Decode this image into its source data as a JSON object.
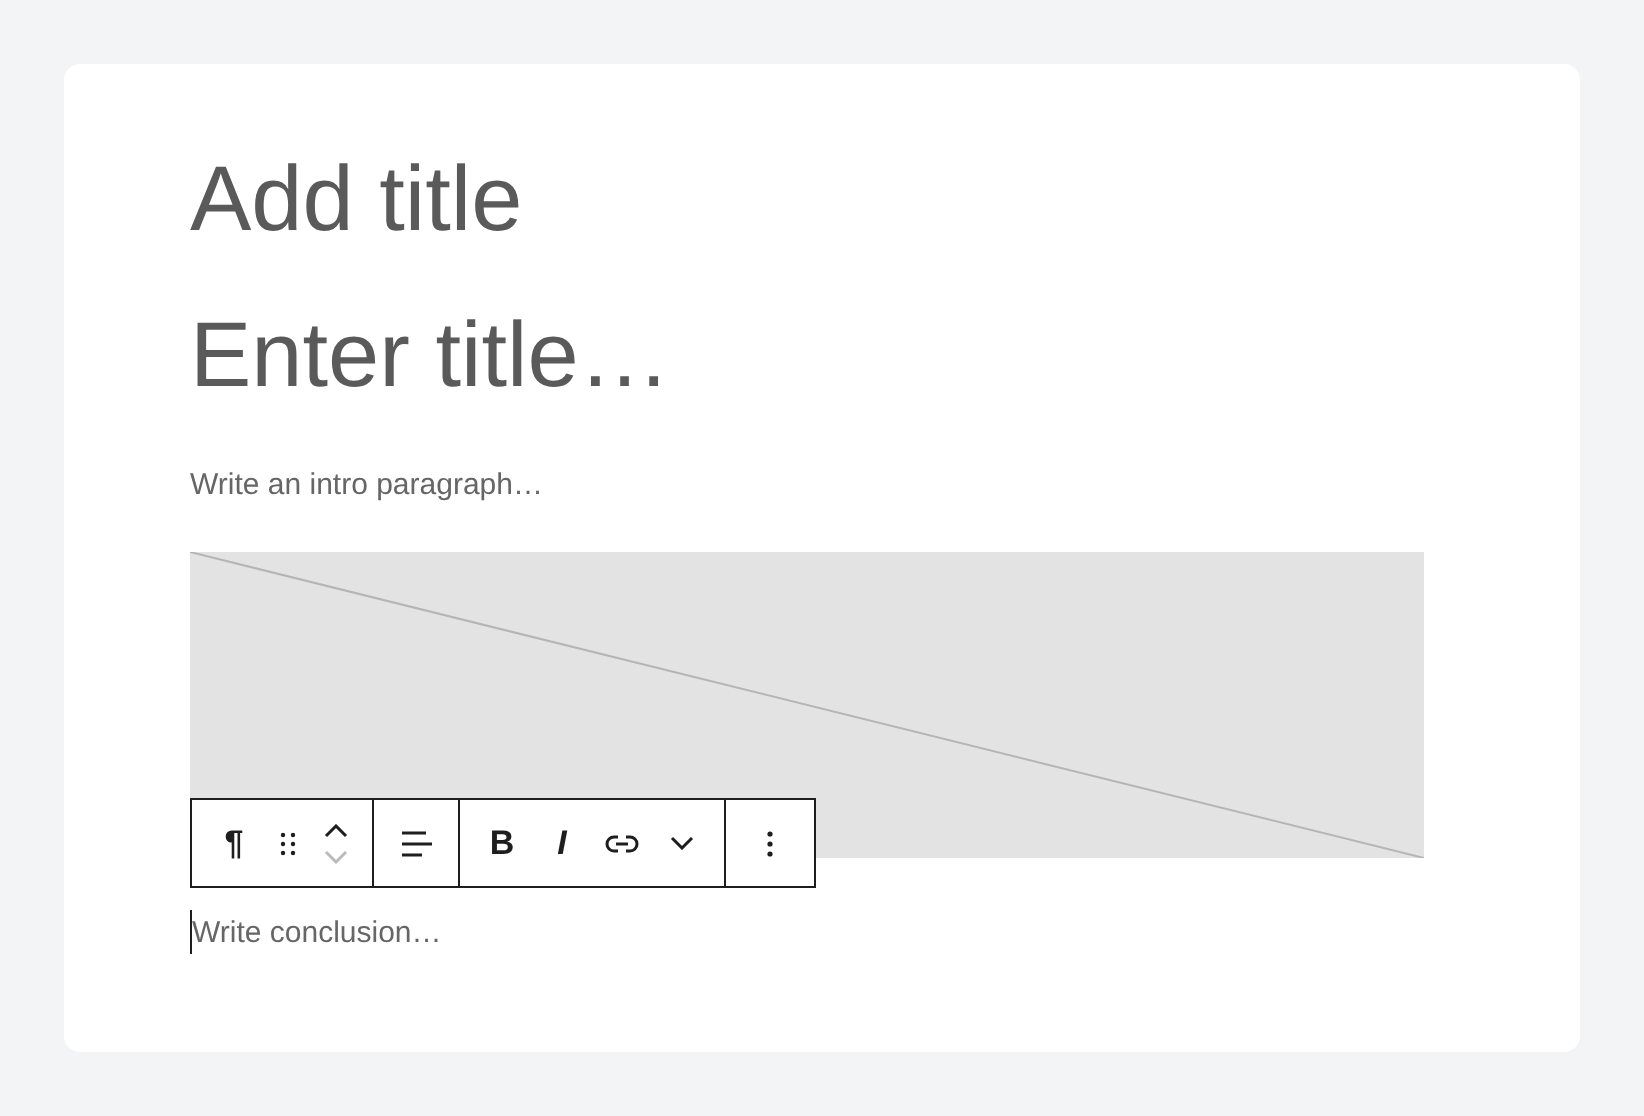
{
  "title": {
    "placeholder": "Add title"
  },
  "heading": {
    "placeholder": "Enter title…"
  },
  "intro": {
    "placeholder": "Write an intro paragraph…"
  },
  "image": {
    "kind": "placeholder"
  },
  "toolbar": {
    "groups": [
      {
        "items": [
          {
            "kind": "paragraph",
            "label": "¶"
          },
          {
            "kind": "drag"
          },
          {
            "kind": "mover",
            "up_disabled": false,
            "down_disabled": true
          }
        ]
      },
      {
        "items": [
          {
            "kind": "align"
          }
        ]
      },
      {
        "items": [
          {
            "kind": "bold",
            "label": "B"
          },
          {
            "kind": "italic",
            "label": "I"
          },
          {
            "kind": "link"
          },
          {
            "kind": "chevron"
          }
        ]
      },
      {
        "items": [
          {
            "kind": "more"
          }
        ]
      }
    ]
  },
  "conclusion": {
    "placeholder": "Write conclusion…",
    "focused": true
  }
}
